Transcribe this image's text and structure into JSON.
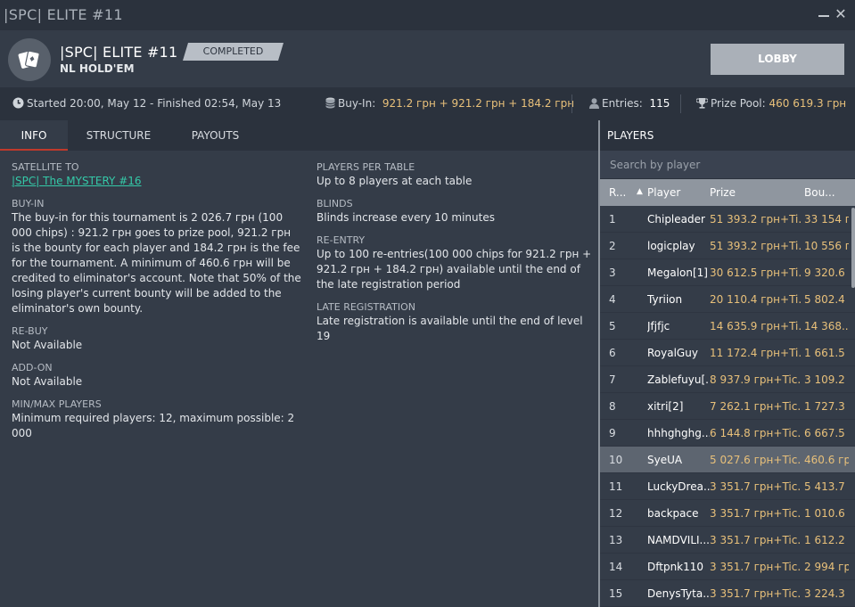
{
  "window": {
    "title": "|SPC| ELITE  #11"
  },
  "header": {
    "name": "|SPC| ELITE  #11",
    "game": "NL HOLD'EM",
    "status": "COMPLETED",
    "lobby_label": "LOBBY"
  },
  "infobar": {
    "times": "Started 20:00, May 12  -  Finished 02:54, May 13",
    "buyin_label": "Buy-In:",
    "buyin_value": "921.2 грн + 921.2 грн + 184.2 грн",
    "entries_label": "Entries:",
    "entries_value": "115",
    "prizepool_label": "Prize Pool:",
    "prizepool_value": "460 619.3 грн"
  },
  "tabs": [
    {
      "label": "INFO"
    },
    {
      "label": "STRUCTURE"
    },
    {
      "label": "PAYOUTS"
    }
  ],
  "info": {
    "satellite_h": "SATELLITE TO",
    "satellite_link": "|SPC| The MYSTERY  #16",
    "buyin_h": "BUY-IN",
    "buyin_b": "The buy-in for this tournament is 2 026.7 грн (100 000 chips) : 921.2 грн goes to prize pool, 921.2 грн is the bounty for each player and 184.2 грн is the fee for the tournament. A minimum of 460.6 грн will be credited to eliminator's account. Note that 50% of the losing player's current bounty will be added to the eliminator's own bounty.",
    "rebuy_h": "RE-BUY",
    "rebuy_b": "Not Available",
    "addon_h": "ADD-ON",
    "addon_b": "Not Available",
    "minmax_h": "MIN/MAX PLAYERS",
    "minmax_b": "Minimum required players: 12, maximum possible: 2 000",
    "ppt_h": "PLAYERS PER TABLE",
    "ppt_b": "Up to 8 players at each table",
    "blinds_h": "BLINDS",
    "blinds_b": "Blinds increase every 10 minutes",
    "reentry_h": "RE-ENTRY",
    "reentry_b": "Up to 100 re-entries(100 000 chips for 921.2 грн + 921.2 грн + 184.2 грн) available until the end of the late registration period",
    "late_h": "LATE REGISTRATION",
    "late_b": "Late registration is available until the end of level 19"
  },
  "players": {
    "title": "PLAYERS",
    "search_placeholder": "Search by player",
    "columns": {
      "rank": "R...",
      "player": "Player",
      "prize": "Prize",
      "bounty": "Bou..."
    },
    "rows": [
      {
        "rank": "1",
        "player": "Chipleader",
        "prize": "51 393.2 грн+Ti...",
        "bounty": "33 154 г..."
      },
      {
        "rank": "2",
        "player": "logicplay",
        "prize": "51 393.2 грн+Ti...",
        "bounty": "10 556 г..."
      },
      {
        "rank": "3",
        "player": "Megalon[1]",
        "prize": "30 612.5 грн+Ti...",
        "bounty": "9 320.6 ..."
      },
      {
        "rank": "4",
        "player": "Tyriion",
        "prize": "20 110.4 грн+Ti...",
        "bounty": "5 802.4 ..."
      },
      {
        "rank": "5",
        "player": "Jfjfjc",
        "prize": "14 635.9 грн+Ti...",
        "bounty": "14 368...."
      },
      {
        "rank": "6",
        "player": "RoyalGuy",
        "prize": "11 172.4 грн+Ti...",
        "bounty": "1 661.5 ..."
      },
      {
        "rank": "7",
        "player": "Zablefuyu[...",
        "prize": "8 937.9 грн+Tic...",
        "bounty": "3 109.2 ..."
      },
      {
        "rank": "8",
        "player": "xitri[2]",
        "prize": "7 262.1 грн+Tic...",
        "bounty": "1 727.3 ..."
      },
      {
        "rank": "9",
        "player": "hhhghghg...",
        "prize": "6 144.8 грн+Tic...",
        "bounty": "6 667.5 ..."
      },
      {
        "rank": "10",
        "player": "SyeUA",
        "prize": "5 027.6 грн+Tic...",
        "bounty": "460.6 грн"
      },
      {
        "rank": "11",
        "player": "LuckyDrea...",
        "prize": "3 351.7 грн+Tic...",
        "bounty": "5 413.7 ..."
      },
      {
        "rank": "12",
        "player": "backpace",
        "prize": "3 351.7 грн+Tic...",
        "bounty": "1 010.6 ..."
      },
      {
        "rank": "13",
        "player": "NAMDVILI...",
        "prize": "3 351.7 грн+Tic...",
        "bounty": "1 612.2 ..."
      },
      {
        "rank": "14",
        "player": "Dftpnk110",
        "prize": "3 351.7 грн+Tic...",
        "bounty": "2 994 гр..."
      },
      {
        "rank": "15",
        "player": "DenysTyta...",
        "prize": "3 351.7 грн+Tic...",
        "bounty": "3 224.3 ..."
      }
    ]
  }
}
